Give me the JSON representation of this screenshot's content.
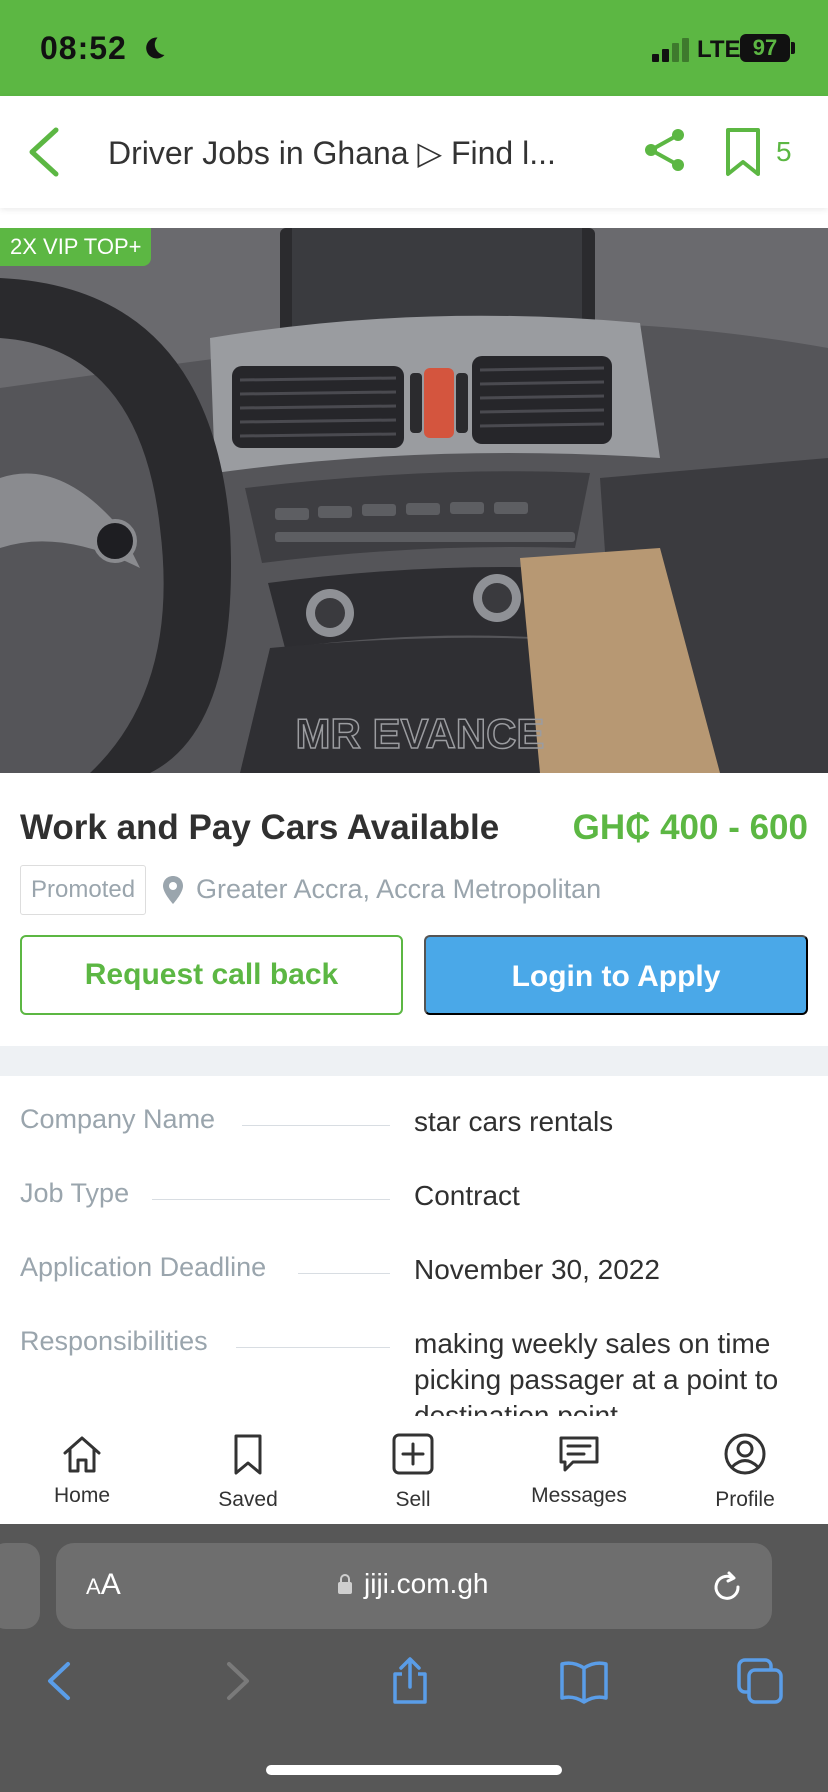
{
  "status_bar": {
    "time": "08:52",
    "network": "LTE",
    "battery": "97"
  },
  "header": {
    "title": "Driver Jobs in Ghana ▷ Find l...",
    "saved_count": "5"
  },
  "hero": {
    "badge": "2X VIP TOP+",
    "watermark": "MR EVANCE"
  },
  "listing": {
    "title": "Work and Pay Cars Available",
    "price": "GH₵ 400 - 600",
    "promoted_label": "Promoted",
    "location": "Greater Accra, Accra Metropolitan",
    "callback_label": "Request call back",
    "apply_label": "Login to Apply"
  },
  "details": [
    {
      "label": "Company Name",
      "value": "star cars rentals"
    },
    {
      "label": "Job Type",
      "value": "Contract"
    },
    {
      "label": "Application Deadline",
      "value": "November 30, 2022"
    },
    {
      "label": "Responsibilities",
      "value": "making weekly sales on time picking passager at a point to destination point"
    }
  ],
  "bottom_nav": [
    {
      "label": "Home",
      "icon": "home-icon"
    },
    {
      "label": "Saved",
      "icon": "bookmark-icon"
    },
    {
      "label": "Sell",
      "icon": "plus-square-icon"
    },
    {
      "label": "Messages",
      "icon": "message-icon"
    },
    {
      "label": "Profile",
      "icon": "profile-icon"
    }
  ],
  "browser": {
    "text_size_label": "AA",
    "url": "jiji.com.gh"
  },
  "colors": {
    "brand_green": "#5cb743",
    "apply_blue": "#4aa8e8",
    "muted_text": "#9aa5ad"
  }
}
